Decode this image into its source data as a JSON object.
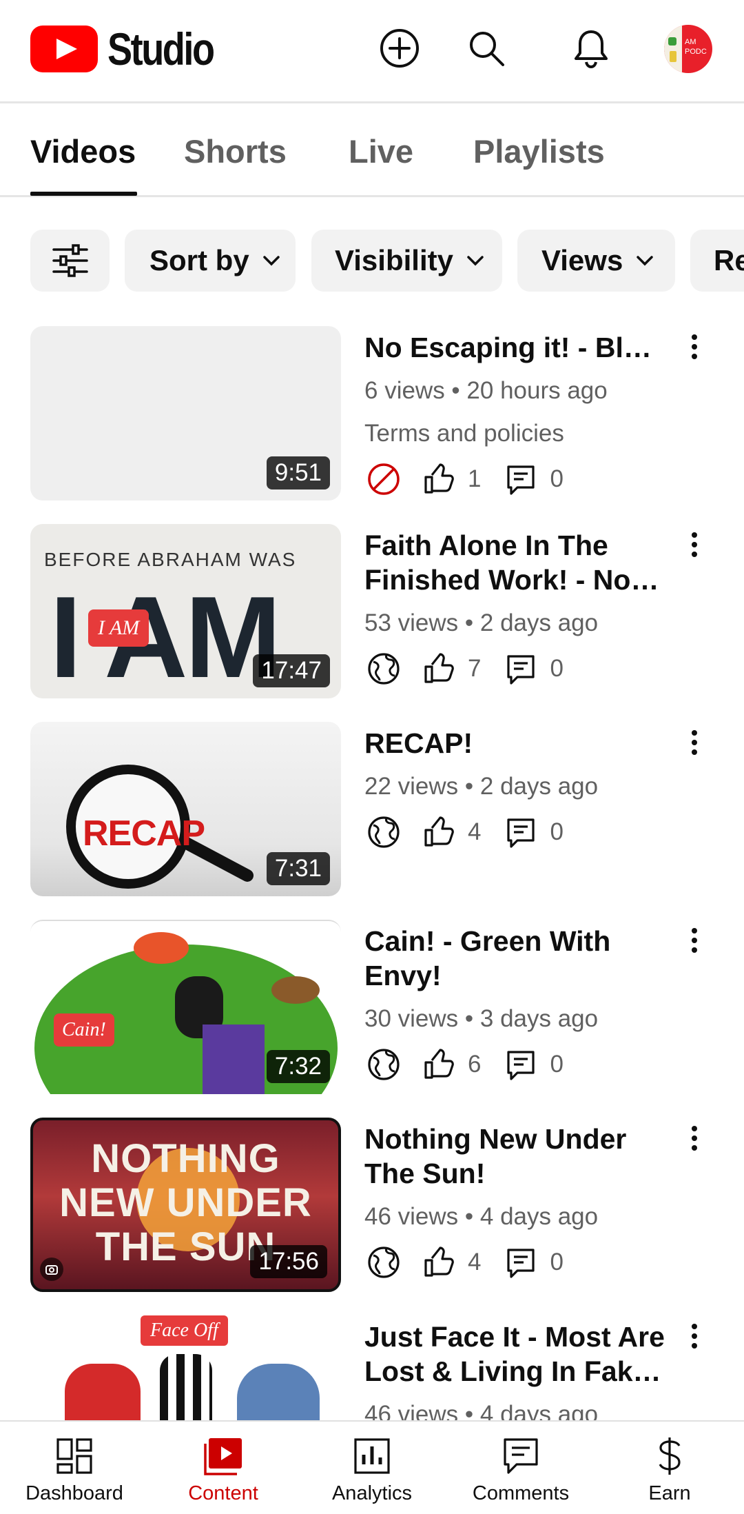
{
  "app": {
    "logo_text": "Studio",
    "avatar_text": "AM PODC"
  },
  "tabs": [
    {
      "label": "Videos",
      "active": true
    },
    {
      "label": "Shorts",
      "active": false
    },
    {
      "label": "Live",
      "active": false
    },
    {
      "label": "Playlists",
      "active": false
    }
  ],
  "filters": {
    "sort_label": "Sort by",
    "visibility_label": "Visibility",
    "views_label": "Views",
    "overflow_label": "Re"
  },
  "videos": [
    {
      "title": "No Escaping it! - Bloo…",
      "meta": "6 views • 20 hours ago",
      "restriction": "Terms and policies",
      "visibility_icon": "blocked-icon",
      "likes": "1",
      "comments": "0",
      "duration": "9:51"
    },
    {
      "title": "Faith Alone In The Finished Work! - Not …",
      "meta": "53 views • 2 days ago",
      "visibility_icon": "globe-icon",
      "likes": "7",
      "comments": "0",
      "duration": "17:47",
      "thumb_text_top": "BEFORE ABRAHAM WAS",
      "thumb_text_big": "I AM",
      "thumb_badge": "I AM"
    },
    {
      "title": "RECAP!",
      "meta": "22 views • 2 days ago",
      "visibility_icon": "globe-icon",
      "likes": "4",
      "comments": "0",
      "duration": "7:31",
      "thumb_text": "RECAP"
    },
    {
      "title": "Cain! - Green With Envy!",
      "meta": "30 views • 3 days ago",
      "visibility_icon": "globe-icon",
      "likes": "6",
      "comments": "0",
      "duration": "7:32",
      "thumb_badge": "Cain!"
    },
    {
      "title": "Nothing New Under The Sun!",
      "meta": "46 views • 4 days ago",
      "visibility_icon": "globe-icon",
      "likes": "4",
      "comments": "0",
      "duration": "17:56",
      "thumb_text_lines": [
        "NOTHING",
        "NEW UNDER",
        "THE SUN"
      ]
    },
    {
      "title": "Just Face It - Most Are Lost & Living In Fake …",
      "meta": "46 views • 4 days ago",
      "thumb_badge": "Face Off"
    }
  ],
  "bottom_nav": [
    {
      "label": "Dashboard",
      "icon": "dashboard-icon",
      "active": false
    },
    {
      "label": "Content",
      "icon": "content-icon",
      "active": true
    },
    {
      "label": "Analytics",
      "icon": "analytics-icon",
      "active": false
    },
    {
      "label": "Comments",
      "icon": "comments-icon",
      "active": false
    },
    {
      "label": "Earn",
      "icon": "dollar-icon",
      "active": false
    }
  ],
  "colors": {
    "brand_red": "#ff0000",
    "active_nav_red": "#cc0000",
    "text_secondary": "#606060",
    "chip_bg": "#f2f2f2"
  }
}
